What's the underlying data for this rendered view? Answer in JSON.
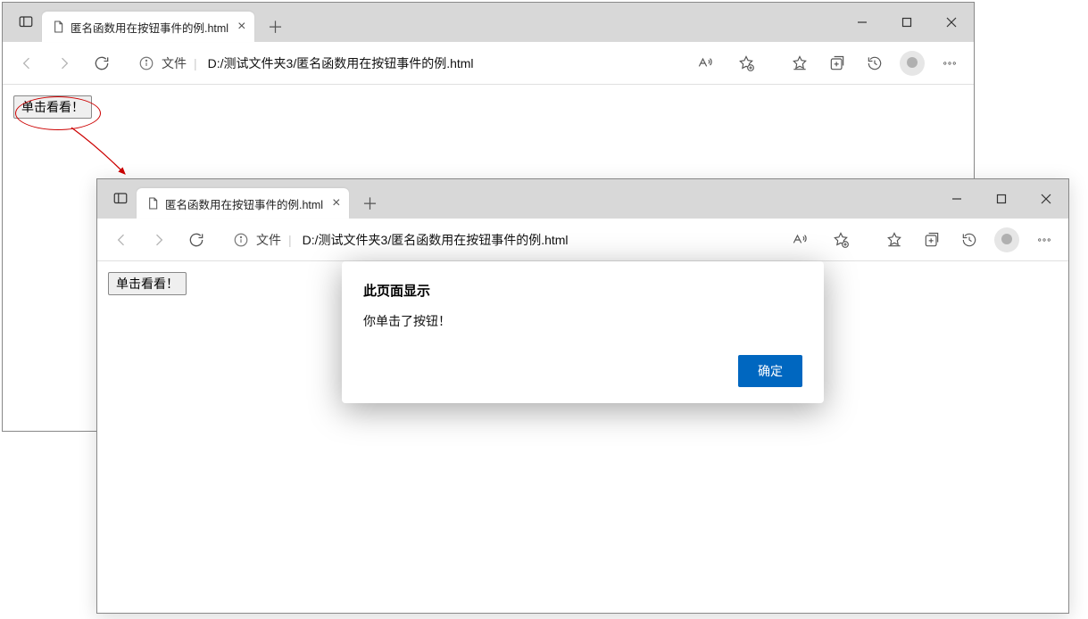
{
  "window1": {
    "tab_title": "匿名函数用在按钮事件的例.html",
    "addr_label": "文件",
    "url": "D:/测试文件夹3/匿名函数用在按钮事件的例.html",
    "button_label": "单击看看！"
  },
  "window2": {
    "tab_title": "匿名函数用在按钮事件的例.html",
    "addr_label": "文件",
    "url": "D:/测试文件夹3/匿名函数用在按钮事件的例.html",
    "button_label": "单击看看！",
    "dialog": {
      "title": "此页面显示",
      "message": "你单击了按钮！",
      "ok_label": "确定"
    }
  }
}
